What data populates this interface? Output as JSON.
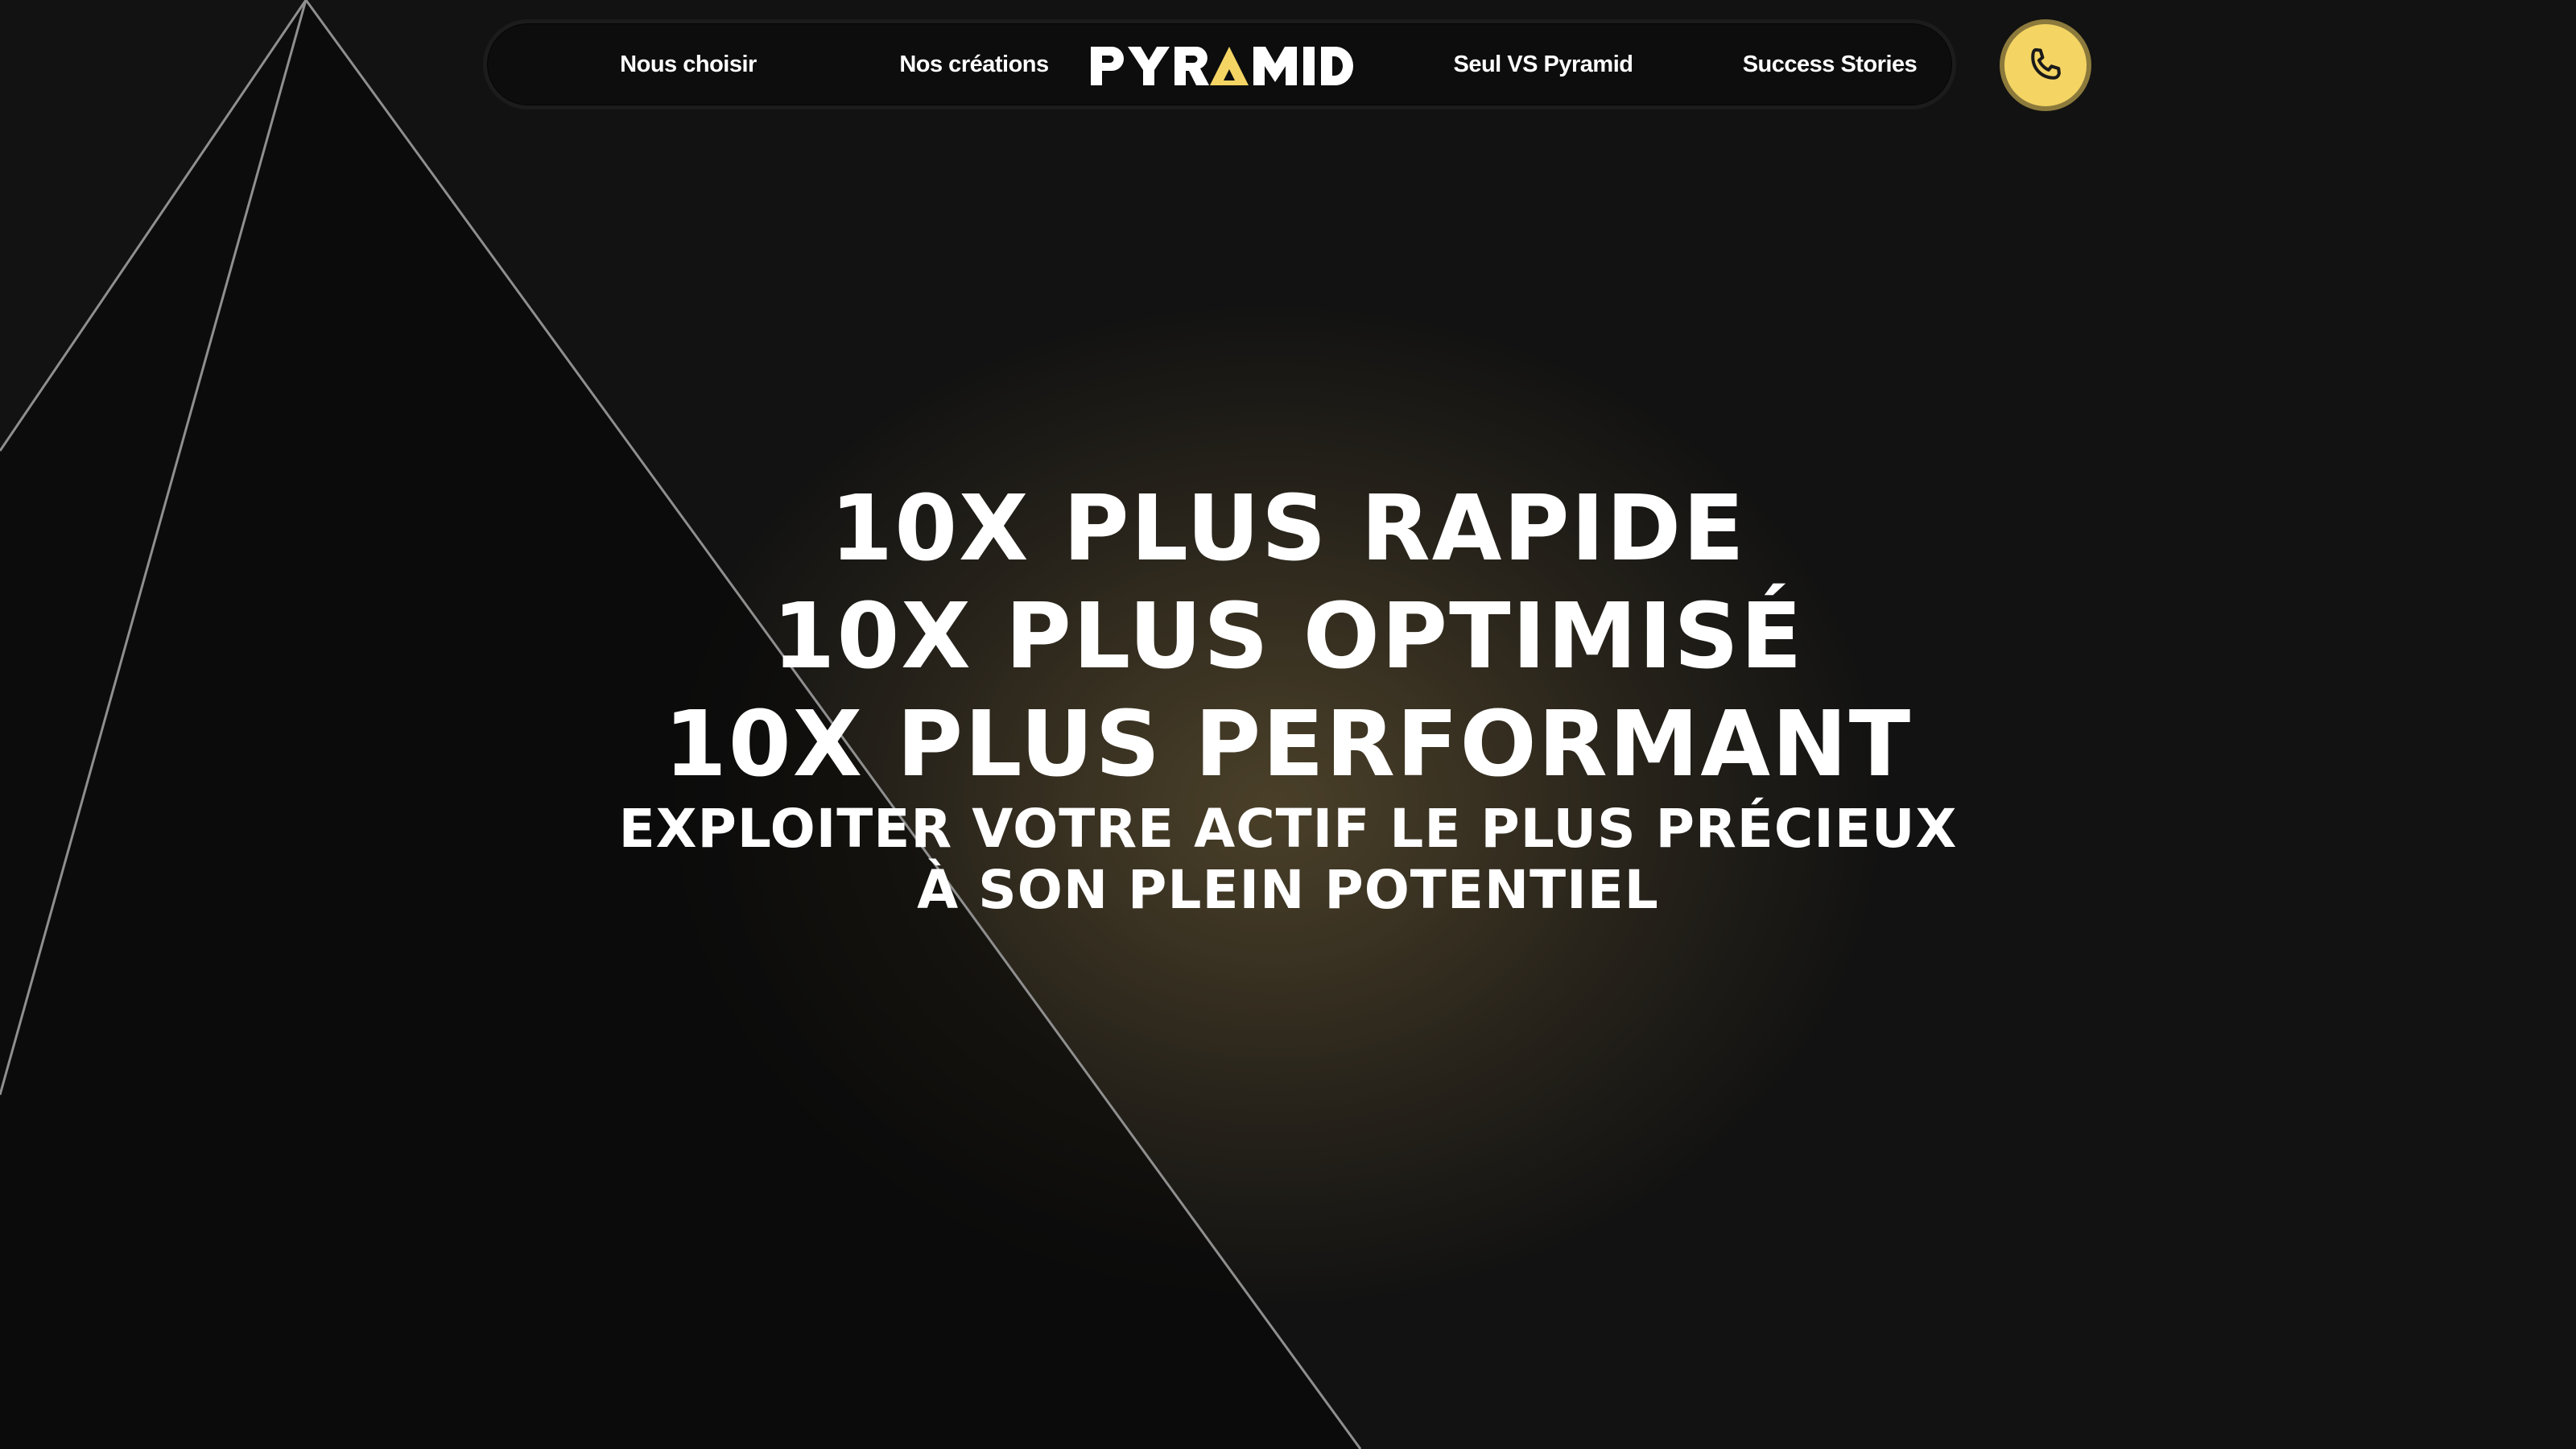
{
  "nav": {
    "items": [
      {
        "label": "Nous choisir"
      },
      {
        "label": "Nos créations"
      },
      {
        "label": "Seul VS Pyramid"
      },
      {
        "label": "Success Stories"
      }
    ],
    "logo_text": "PYRAMID",
    "phone_icon": "phone-icon"
  },
  "hero": {
    "lines": [
      "10X PLUS RAPIDE",
      "10X PLUS OPTIMISÉ",
      "10X PLUS PERFORMANT"
    ],
    "sub_lines": [
      "EXPLOITER VOTRE ACTIF LE PLUS PRÉCIEUX",
      "À SON PLEIN POTENTIEL"
    ]
  },
  "colors": {
    "accent": "#f4d463",
    "background": "#121212",
    "text": "#ffffff"
  }
}
